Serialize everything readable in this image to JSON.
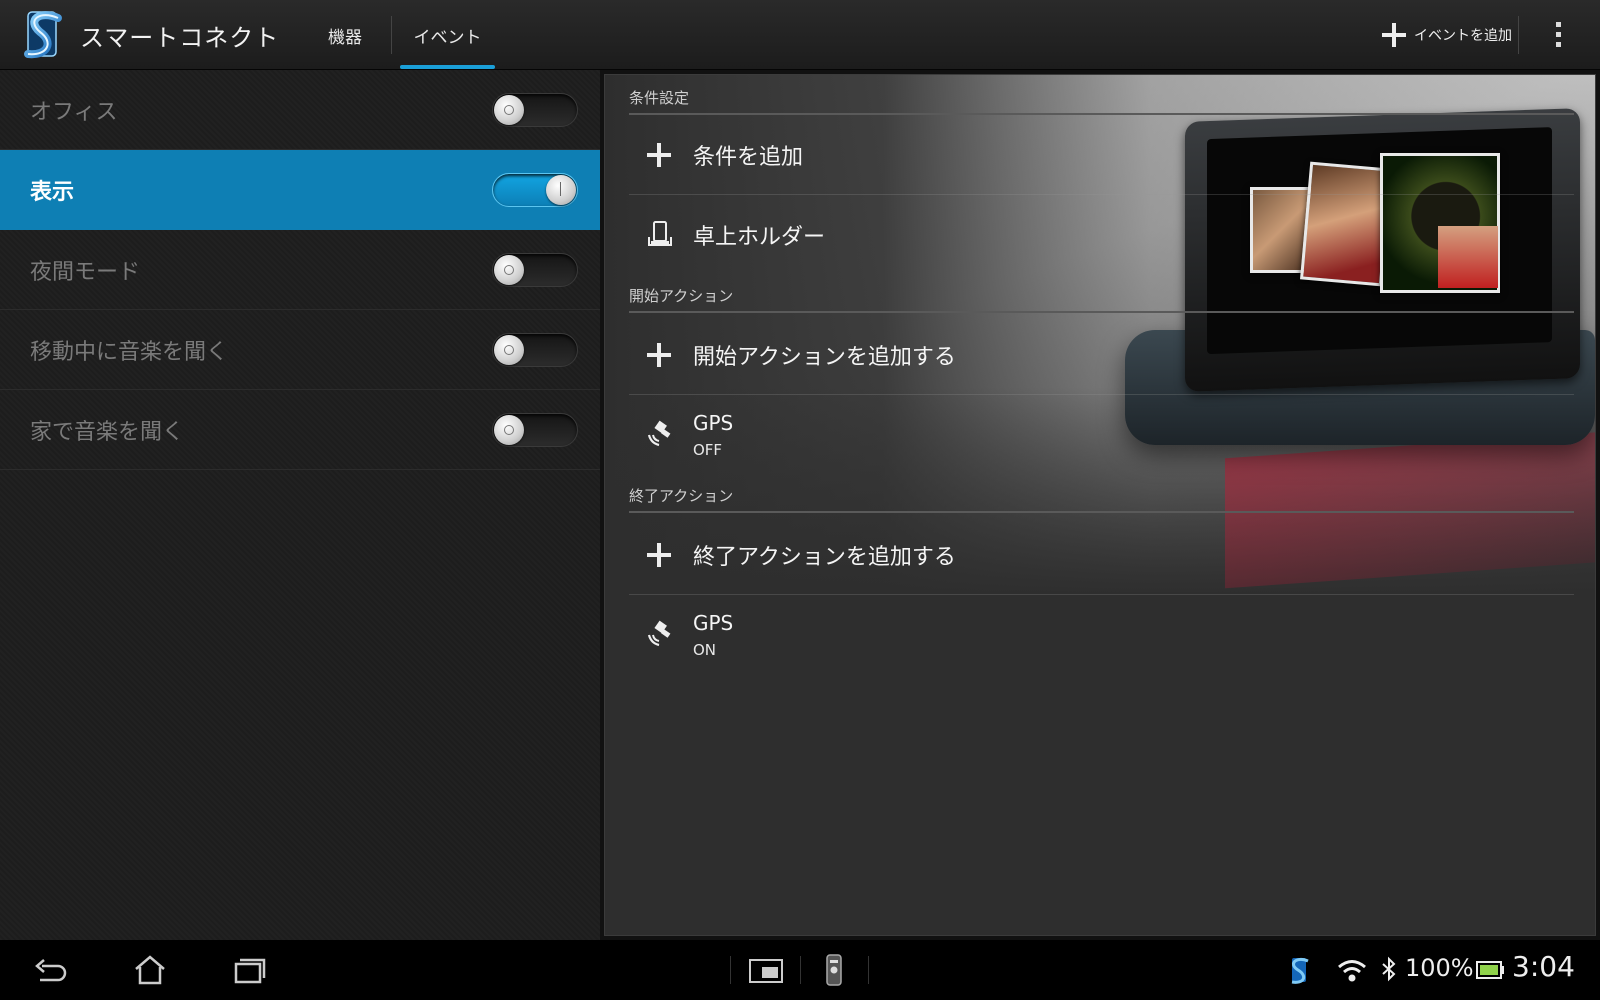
{
  "app": {
    "title": "スマートコネクト"
  },
  "tabs": [
    {
      "label": "機器",
      "selected": false
    },
    {
      "label": "イベント",
      "selected": true
    }
  ],
  "actions": {
    "add_event_label": "イベントを追加"
  },
  "events": [
    {
      "label": "オフィス",
      "enabled": false,
      "selected": false
    },
    {
      "label": "表示",
      "enabled": true,
      "selected": true
    },
    {
      "label": "夜間モード",
      "enabled": false,
      "selected": false
    },
    {
      "label": "移動中に音楽を聞く",
      "enabled": false,
      "selected": false
    },
    {
      "label": "家で音楽を聞く",
      "enabled": false,
      "selected": false
    }
  ],
  "detail": {
    "conditions": {
      "header": "条件設定",
      "add_label": "条件を追加",
      "items": [
        {
          "label": "卓上ホルダー",
          "icon": "dock-icon"
        }
      ]
    },
    "start_actions": {
      "header": "開始アクション",
      "add_label": "開始アクションを追加する",
      "items": [
        {
          "title": "GPS",
          "value": "OFF",
          "icon": "gps-icon"
        }
      ]
    },
    "end_actions": {
      "header": "終了アクション",
      "add_label": "終了アクションを追加する",
      "items": [
        {
          "title": "GPS",
          "value": "ON",
          "icon": "gps-icon"
        }
      ]
    }
  },
  "status_bar": {
    "battery": "100%",
    "time": "3:04"
  },
  "colors": {
    "accent": "#1a9fd8",
    "selected_row": "#0e7fb4"
  }
}
